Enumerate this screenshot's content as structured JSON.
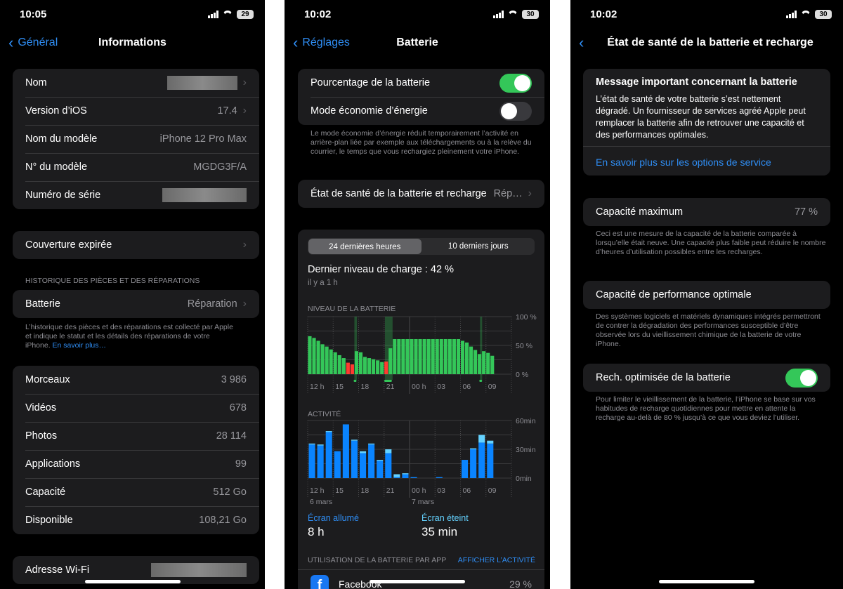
{
  "screens": [
    {
      "status": {
        "time": "10:05",
        "battery": "29"
      },
      "nav": {
        "back": "Général",
        "title": "Informations"
      },
      "about": [
        {
          "label": "Nom",
          "value": "",
          "redacted": true,
          "chevron": true
        },
        {
          "label": "Version d’iOS",
          "value": "17.4",
          "chevron": true
        },
        {
          "label": "Nom du modèle",
          "value": "iPhone 12 Pro Max"
        },
        {
          "label": "N° du modèle",
          "value": "MGDG3F/A"
        },
        {
          "label": "Numéro de série",
          "value": "",
          "redacted": true
        }
      ],
      "coverage": "Couverture expirée",
      "parts_header": "HISTORIQUE DES PIÈCES ET DES RÉPARATIONS",
      "parts": {
        "label": "Batterie",
        "value": "Réparation"
      },
      "parts_footer": "L’historique des pièces et des réparations est collecté par Apple et indique le statut et les détails des réparations de votre iPhone.",
      "parts_link": "En savoir plus…",
      "stats": [
        {
          "label": "Morceaux",
          "value": "3 986"
        },
        {
          "label": "Vidéos",
          "value": "678"
        },
        {
          "label": "Photos",
          "value": "28 114"
        },
        {
          "label": "Applications",
          "value": "99"
        },
        {
          "label": "Capacité",
          "value": "512 Go"
        },
        {
          "label": "Disponible",
          "value": "108,21 Go"
        }
      ],
      "wifi": {
        "label": "Adresse Wi-Fi",
        "redacted": true
      }
    },
    {
      "status": {
        "time": "10:02",
        "battery": "30"
      },
      "nav": {
        "back": "Réglages",
        "title": "Batterie"
      },
      "toggles": [
        {
          "label": "Pourcentage de la batterie",
          "on": true
        },
        {
          "label": "Mode économie d’énergie",
          "on": false
        }
      ],
      "lowpower_footer": "Le mode économie d’énergie réduit temporairement l’activité en arrière-plan liée par exemple aux téléchargements ou à la relève du courrier, le temps que vous rechargiez pleinement votre iPhone.",
      "health": {
        "label": "État de santé de la batterie et recharge",
        "value": "Rép…"
      },
      "tabs": [
        "24 dernières heures",
        "10 derniers jours"
      ],
      "selected_tab": 0,
      "last_charge": "Dernier niveau de charge : 42 %",
      "last_charge_time": "il y a 1 h",
      "on_label": "Écran allumé",
      "on_value": "8 h",
      "off_label": "Écran éteint",
      "off_value": "35 min",
      "usage_header": "UTILISATION DE LA BATTERIE PAR APP",
      "usage_link": "AFFICHER L’ACTIVITÉ",
      "apps": [
        {
          "name": "Facebook",
          "value": "29 %",
          "icon": "facebook-icon"
        }
      ]
    },
    {
      "status": {
        "time": "10:02",
        "battery": "30"
      },
      "nav": {
        "title": "État de santé de la batterie et recharge"
      },
      "message_title": "Message important concernant la batterie",
      "message_body": "L’état de santé de votre batterie s’est nettement dégradé. Un fournisseur de services agréé Apple peut remplacer la batterie afin de retrouver une capacité et des performances optimales.",
      "message_link": "En savoir plus sur les options de service",
      "max_capacity": {
        "label": "Capacité maximum",
        "value": "77 %"
      },
      "max_footer": "Ceci est une mesure de la capacité de la batterie comparée à lorsqu’elle était neuve. Une capacité plus faible peut réduire le nombre d’heures d’utilisation possibles entre les recharges.",
      "perf": "Capacité de performance optimale",
      "perf_footer": "Des systèmes logiciels et matériels dynamiques intégrés permettront de contrer la dégradation des performances susceptible d’être observée lors du vieillissement chimique de la batterie de votre iPhone.",
      "optimized": {
        "label": "Rech. optimisée de la batterie",
        "on": true
      },
      "optimized_footer": "Pour limiter le vieillissement de la batterie, l’iPhone se base sur vos habitudes de recharge quotidiennes pour mettre en attente la recharge au-delà de 80 % jusqu’à ce que vous deviez l’utiliser."
    }
  ],
  "chart_data": [
    {
      "type": "bar",
      "title": "NIVEAU DE LA BATTERIE",
      "ylim": [
        0,
        100
      ],
      "y_ticks": [
        "100 %",
        "50 %",
        "0 %"
      ],
      "x_ticks": [
        "12 h",
        "15",
        "18",
        "21",
        "00 h",
        "03",
        "06",
        "09"
      ],
      "x_start": "12:00",
      "interval_min": 30,
      "values": [
        66,
        63,
        58,
        52,
        48,
        43,
        38,
        33,
        28,
        20,
        17,
        40,
        38,
        30,
        28,
        26,
        24,
        21,
        22,
        45,
        61,
        61,
        61,
        61,
        61,
        61,
        61,
        61,
        61,
        61,
        61,
        61,
        61,
        61,
        61,
        61,
        58,
        55,
        48,
        42,
        35,
        40,
        37,
        32
      ],
      "low": [
        9,
        10,
        18
      ],
      "charging_at": [
        "17:30",
        "21:00-22:00",
        "08:30"
      ],
      "colors": {
        "normal": "#34c759",
        "low": "#ff3b30"
      }
    },
    {
      "type": "bar",
      "title": "ACTIVITÉ",
      "ylim": [
        0,
        60
      ],
      "y_ticks": [
        "60min",
        "30min",
        "0min"
      ],
      "x_ticks": [
        "12 h",
        "15",
        "18",
        "21",
        "00 h",
        "03",
        "06",
        "09"
      ],
      "dates": [
        "6 mars",
        "7 mars"
      ],
      "hours": [
        "12",
        "13",
        "14",
        "15",
        "16",
        "17",
        "18",
        "19",
        "20",
        "21",
        "22",
        "23",
        "00",
        "01",
        "02",
        "03",
        "04",
        "05",
        "06",
        "07",
        "08",
        "09"
      ],
      "series": [
        {
          "name": "Écran allumé",
          "color": "#0a84ff",
          "values": [
            35,
            34,
            48,
            28,
            56,
            39,
            26,
            35,
            18,
            26,
            1,
            4,
            1,
            0,
            0,
            1,
            0,
            0,
            19,
            30,
            37,
            36
          ]
        },
        {
          "name": "Écran éteint",
          "color": "#64d2ff",
          "values": [
            1,
            1,
            1,
            0,
            0,
            1,
            2,
            1,
            1,
            4,
            3,
            1,
            0,
            0,
            0,
            0,
            0,
            0,
            0,
            1,
            8,
            3
          ]
        }
      ]
    }
  ]
}
